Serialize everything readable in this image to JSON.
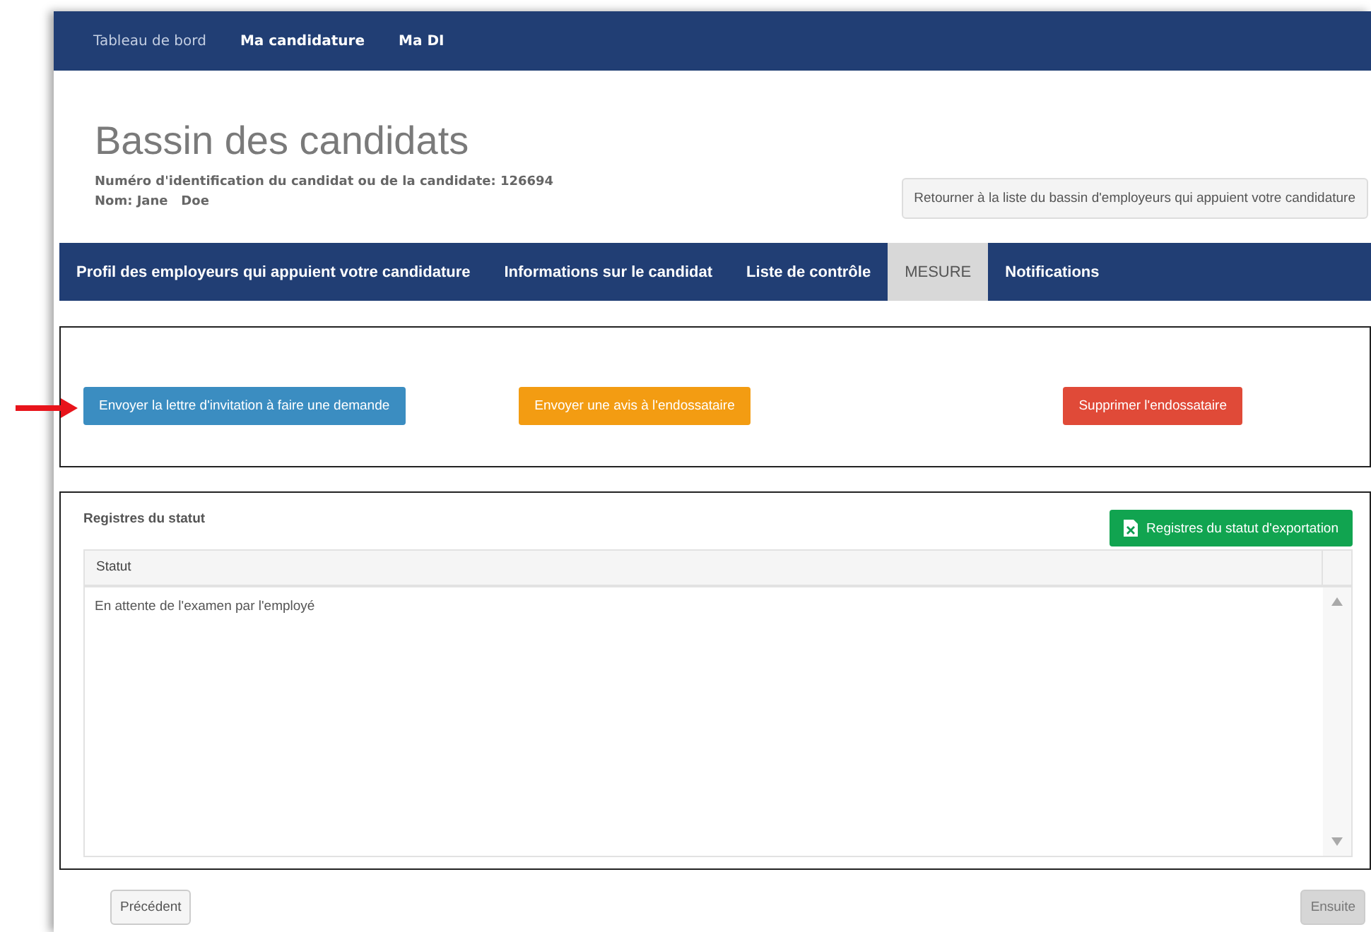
{
  "top_nav": [
    {
      "label": "Tableau de bord",
      "selected": true
    },
    {
      "label": "Ma candidature",
      "selected": false
    },
    {
      "label": "Ma DI",
      "selected": false
    }
  ],
  "header": {
    "title": "Bassin des candidats",
    "id_line": "Numéro d'identification du candidat ou de la candidate: 126694",
    "name_line": "Nom: Jane   Doe",
    "return_button": "Retourner à la liste du bassin d'employeurs qui appuient votre candidature"
  },
  "tabs": [
    {
      "label": "Profil des employeurs qui appuient votre candidature",
      "selected": false
    },
    {
      "label": "Informations sur le candidat",
      "selected": false
    },
    {
      "label": "Liste de contrôle",
      "selected": false
    },
    {
      "label": "MESURE",
      "selected": true
    },
    {
      "label": "Notifications",
      "selected": false
    }
  ],
  "actions": [
    {
      "label": "Envoyer la lettre d'invitation à faire une demande",
      "kind": "info",
      "pointed": true
    },
    {
      "label": "Envoyer une avis à l'endossataire",
      "kind": "warning",
      "pointed": false
    },
    {
      "label": "Supprimer l'endossataire",
      "kind": "danger",
      "pointed": false
    }
  ],
  "status_log": {
    "title": "Registres du statut",
    "export_button": "Registres du statut d'exportation",
    "columns": [
      "Statut"
    ],
    "rows": [
      [
        "En attente de l'examen par l'employé"
      ]
    ]
  },
  "footer": {
    "previous": {
      "label": "Précédent",
      "disabled": false
    },
    "next": {
      "label": "Ensuite",
      "disabled": true
    }
  }
}
